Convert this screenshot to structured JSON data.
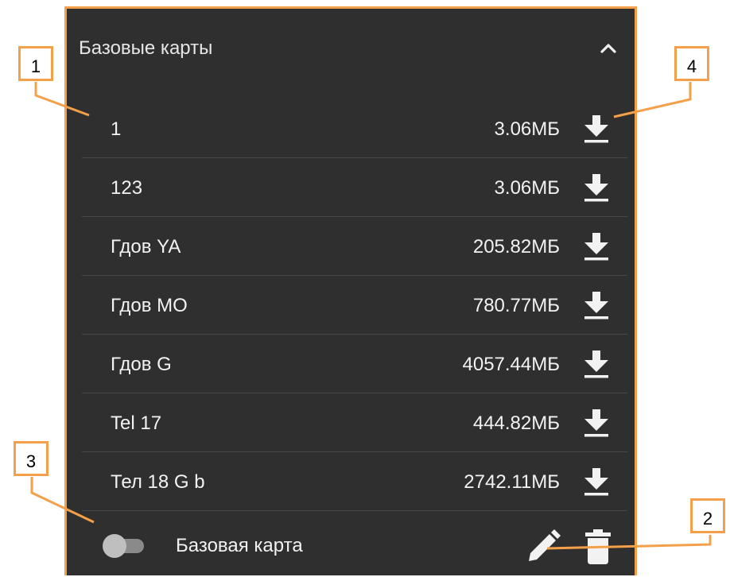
{
  "section": {
    "title": "Базовые карты",
    "collapse_icon": "chevron-up-icon"
  },
  "maps": [
    {
      "name": "1",
      "size": "3.06МБ",
      "icon": "download-icon"
    },
    {
      "name": "123",
      "size": "3.06МБ",
      "icon": "download-icon"
    },
    {
      "name": "Гдов YA",
      "size": "205.82МБ",
      "icon": "download-icon"
    },
    {
      "name": "Гдов MO",
      "size": "780.77МБ",
      "icon": "download-icon"
    },
    {
      "name": "Гдов G",
      "size": "4057.44МБ",
      "icon": "download-icon"
    },
    {
      "name": "Tel 17",
      "size": "444.82МБ",
      "icon": "download-icon"
    },
    {
      "name": "Тел 18 G b",
      "size": "2742.11МБ",
      "icon": "download-icon"
    }
  ],
  "base_map": {
    "toggle_label": "Базовая карта",
    "toggle_on": false,
    "edit_icon": "pencil-icon",
    "delete_icon": "trash-icon"
  },
  "callouts": [
    "1",
    "2",
    "3",
    "4"
  ],
  "colors": {
    "panel_bg": "#2f2f2f",
    "accent_orange": "#f4a04a",
    "text": "#f2f2f2",
    "divider": "#474747"
  }
}
